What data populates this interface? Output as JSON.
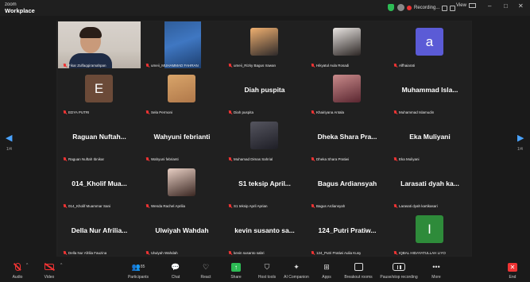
{
  "app": {
    "brand_top": "zoom",
    "brand_name": "Workplace",
    "recording_label": "Recording...",
    "view_label": "View"
  },
  "window_controls": [
    "–",
    "□",
    "✕"
  ],
  "pagination": {
    "left": "1/4",
    "right": "1/4"
  },
  "tiles": [
    {
      "kind": "video-a",
      "label": "Fikar Zulfaqqiramahpan"
    },
    {
      "kind": "video-b",
      "label": "umeii_MUHAMMAD FAHRAN"
    },
    {
      "kind": "photo",
      "photo_colors": [
        "#f0b070",
        "#2e2a2a"
      ],
      "label": "umeii_Rizky Bagus Irawan"
    },
    {
      "kind": "photo",
      "photo_colors": [
        "#e9e5e2",
        "#2c2624"
      ],
      "label": "Hikyatul Aula Rosadi"
    },
    {
      "kind": "avatar",
      "initial": "a",
      "color": "#5b5bd6",
      "label": "Alfhaiarati"
    },
    {
      "kind": "avatar",
      "initial": "E",
      "color": "#6b4a38",
      "label": "EDYA PUTRI"
    },
    {
      "kind": "photo",
      "photo_colors": [
        "#d9a56a",
        "#b0784a"
      ],
      "label": "Sela Permoni"
    },
    {
      "kind": "name",
      "name": "Diah puspita",
      "label": "Diah puspita"
    },
    {
      "kind": "photo",
      "photo_colors": [
        "#c98b8b",
        "#5a2630"
      ],
      "label": "Khairiyana Antala"
    },
    {
      "kind": "name",
      "name": "Muhammad Isla...",
      "label": "Muhammad Islamudin"
    },
    {
      "kind": "name",
      "name": "Raguan Nuftah...",
      "label": "Raguan Nuftah Ibnikar"
    },
    {
      "kind": "name",
      "name": "Wahyuni febrianti",
      "label": "Wahyuni febrianti"
    },
    {
      "kind": "photo",
      "photo_colors": [
        "#55555f",
        "#1e1e26"
      ],
      "label": "Muhamad Dimas Sahrial"
    },
    {
      "kind": "name",
      "name": "Dheka Shara Pra...",
      "label": "Dheka Shara Pratiwi"
    },
    {
      "kind": "name",
      "name": "Eka Muliyani",
      "label": "Eka Muliyani"
    },
    {
      "kind": "name",
      "name": "014_Kholif Mua...",
      "label": "014_Kholif Muammar Sani"
    },
    {
      "kind": "photo",
      "photo_colors": [
        "#e8cfc4",
        "#3a2722"
      ],
      "label": "Wenda Rachel Aprilia"
    },
    {
      "kind": "name",
      "name": "S1 teksip April...",
      "label": "S1 teksip April Aprian"
    },
    {
      "kind": "name",
      "name": "Bagus Ardiansyah",
      "label": "Bagus Ardiansyah"
    },
    {
      "kind": "name",
      "name": "Larasati dyah ka...",
      "label": "Larasati dyah kartikasari"
    },
    {
      "kind": "name",
      "name": "Della Nur Afrilia...",
      "label": "Della Nur Afrilia Fauzina"
    },
    {
      "kind": "name",
      "name": "Ulwiyah Wahdah",
      "label": "Ulwiyah Wahdah"
    },
    {
      "kind": "name",
      "name": "kevin susanto sa...",
      "label": "kevin susanto sabri"
    },
    {
      "kind": "name",
      "name": "124_Putri Pratiw...",
      "label": "124_Putri Pratiwi Aulia Kusy"
    },
    {
      "kind": "avatar",
      "initial": "I",
      "color": "#2e8b3a",
      "label": "IQBAL HIDAYATULLAH LIYO"
    }
  ],
  "toolbar": {
    "audio": "Audio",
    "video": "Video",
    "participants_count": "85",
    "participants": "Participants",
    "chat": "Chat",
    "react": "React",
    "share": "Share",
    "host_tools": "Host tools",
    "ai_companion": "AI Companion",
    "apps": "Apps",
    "breakout_rooms": "Breakout rooms",
    "pause_stop_recording": "Pause/stop recording",
    "more": "More",
    "end": "End"
  }
}
